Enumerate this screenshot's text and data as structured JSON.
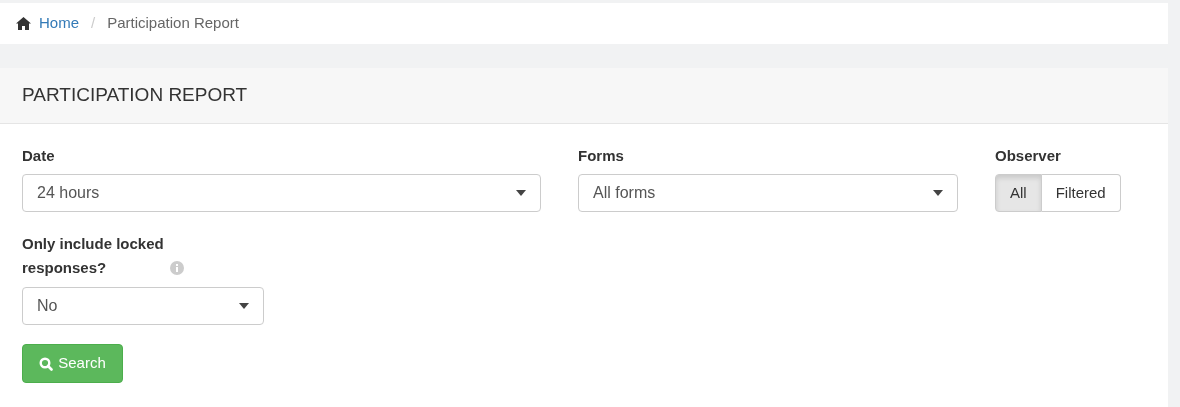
{
  "breadcrumb": {
    "home": "Home",
    "separator": "/",
    "current": "Participation Report"
  },
  "panel": {
    "title": "PARTICIPATION REPORT"
  },
  "filters": {
    "date": {
      "label": "Date",
      "value": "24 hours"
    },
    "forms": {
      "label": "Forms",
      "value": "All forms"
    },
    "observer": {
      "label": "Observer",
      "options": [
        {
          "label": "All",
          "selected": true
        },
        {
          "label": "Filtered",
          "selected": false
        }
      ]
    },
    "locked": {
      "label": "Only include locked responses?",
      "value": "No"
    }
  },
  "search_button": "Search"
}
